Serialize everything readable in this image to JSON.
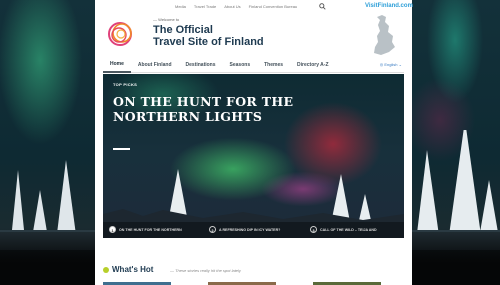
{
  "utility": {
    "links": [
      "Media",
      "Travel Trade",
      "About Us",
      "Finland Convention Bureau"
    ],
    "brand_url": "VisitFinland.com"
  },
  "header": {
    "welcome": "— Welcome to",
    "title_line1": "The Official",
    "title_line2": "Travel Site of Finland"
  },
  "nav": {
    "items": [
      "Home",
      "About Finland",
      "Destinations",
      "Seasons",
      "Themes",
      "Directory A-Z"
    ],
    "active": "Home",
    "language": "English"
  },
  "hero": {
    "kicker": "TOP PICKS",
    "title": "ON THE HUNT FOR THE NORTHERN LIGHTS",
    "tabs": [
      {
        "num": "1",
        "label": "ON THE HUNT FOR THE NORTHERN"
      },
      {
        "num": "2",
        "label": "A REFRESHING DIP IN ICY WATER?"
      },
      {
        "num": "3",
        "label": "CALL OF THE WILD – TEIJA AND"
      }
    ]
  },
  "whats_hot": {
    "title": "What's Hot",
    "subtitle": "— These stories really hit the spot lately"
  },
  "colors": {
    "accent_blue": "#2d9fd8",
    "title_navy": "#1e3a50",
    "hot_green": "#b7cf2a"
  },
  "icons": [
    "search-icon",
    "finland-logo-icon",
    "finland-map-icon",
    "globe-icon"
  ]
}
